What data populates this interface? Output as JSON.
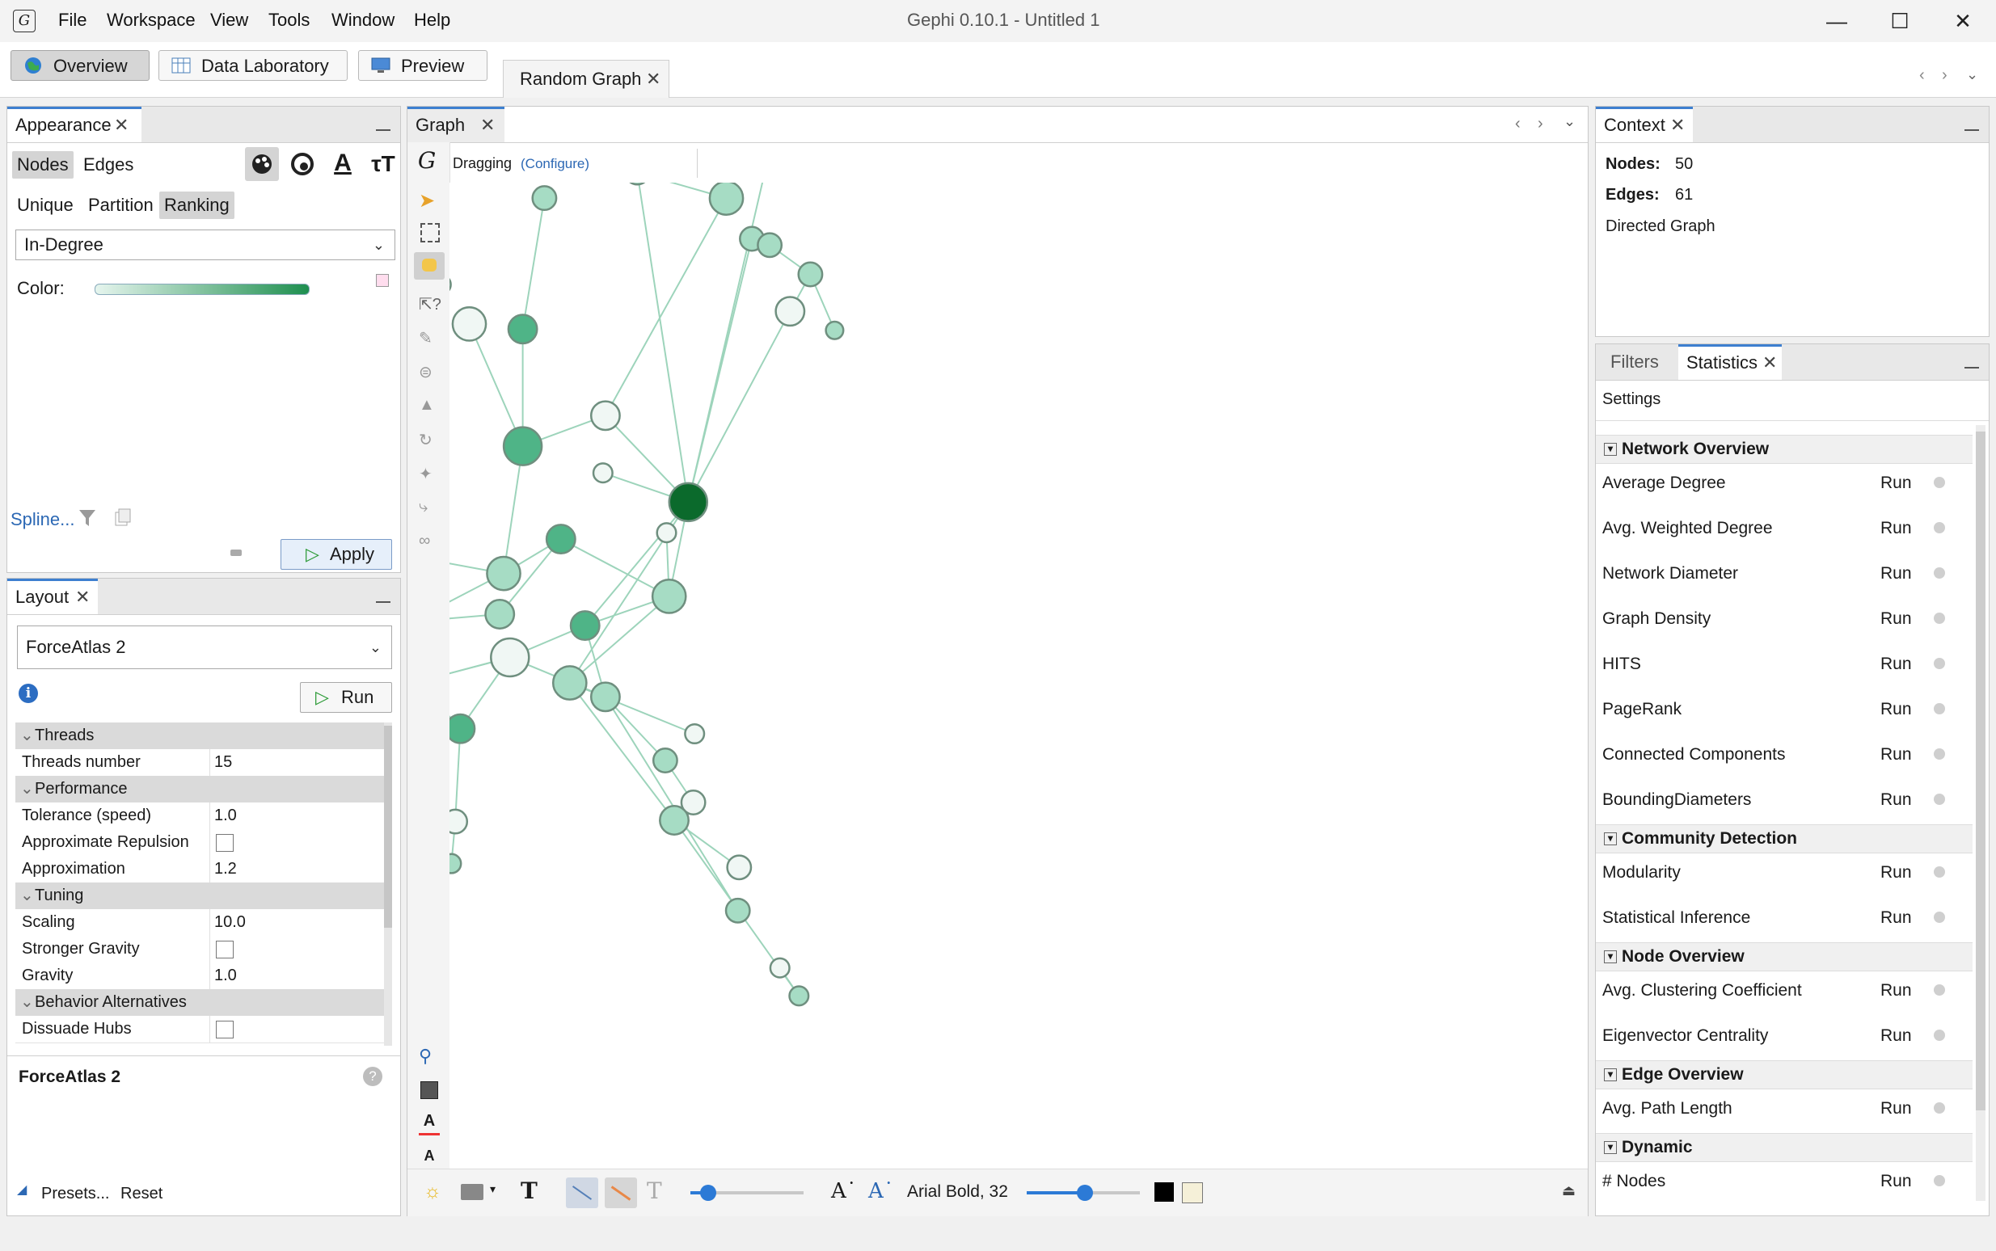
{
  "app": {
    "title": "Gephi 0.10.1 - Untitled 1",
    "menu": [
      "File",
      "Workspace",
      "View",
      "Tools",
      "Window",
      "Help"
    ]
  },
  "toolbar": {
    "overview": "Overview",
    "data_lab": "Data Laboratory",
    "preview": "Preview",
    "workspace_tab": "Random Graph"
  },
  "appearance": {
    "title": "Appearance",
    "tabs": [
      "Nodes",
      "Edges"
    ],
    "modes": [
      "Unique",
      "Partition",
      "Ranking"
    ],
    "attribute": "In-Degree",
    "color_label": "Color:",
    "gradient": [
      "#e6f5ee",
      "#1e8f4f"
    ],
    "spline_link": "Spline...",
    "apply": "Apply"
  },
  "layout": {
    "title": "Layout",
    "algorithm": "ForceAtlas 2",
    "run": "Run",
    "groups": [
      {
        "name": "Threads",
        "rows": [
          {
            "k": "Threads number",
            "v": "15"
          }
        ]
      },
      {
        "name": "Performance",
        "rows": [
          {
            "k": "Tolerance (speed)",
            "v": "1.0"
          },
          {
            "k": "Approximate Repulsion",
            "v": "",
            "check": true
          },
          {
            "k": "Approximation",
            "v": "1.2"
          }
        ]
      },
      {
        "name": "Tuning",
        "rows": [
          {
            "k": "Scaling",
            "v": "10.0"
          },
          {
            "k": "Stronger Gravity",
            "v": "",
            "check": true
          },
          {
            "k": "Gravity",
            "v": "1.0"
          }
        ]
      },
      {
        "name": "Behavior Alternatives",
        "rows": [
          {
            "k": "Dissuade Hubs",
            "v": "",
            "check": true
          }
        ]
      }
    ],
    "desc_title": "ForceAtlas 2",
    "presets": "Presets...",
    "reset": "Reset"
  },
  "graph": {
    "tab": "Graph",
    "mode": "Dragging",
    "configure": "(Configure)",
    "font_label": "Arial Bold, 32",
    "node_colors": {
      "light": "#f0f7f4",
      "mid": "#a6dcc4",
      "dark": "#4fb487",
      "darkest": "#0b6a2c"
    }
  },
  "context": {
    "title": "Context",
    "nodes_label": "Nodes:",
    "nodes_value": "50",
    "edges_label": "Edges:",
    "edges_value": "61",
    "graph_type": "Directed Graph"
  },
  "statistics": {
    "tabs": [
      "Filters",
      "Statistics"
    ],
    "settings": "Settings",
    "run_label": "Run",
    "sections": [
      {
        "title": "Network Overview",
        "items": [
          "Average Degree",
          "Avg. Weighted Degree",
          "Network Diameter",
          "Graph Density",
          "HITS",
          "PageRank",
          "Connected Components",
          "BoundingDiameters"
        ]
      },
      {
        "title": "Community Detection",
        "items": [
          "Modularity",
          "Statistical Inference"
        ]
      },
      {
        "title": "Node Overview",
        "items": [
          "Avg. Clustering Coefficient",
          "Eigenvector Centrality"
        ]
      },
      {
        "title": "Edge Overview",
        "items": [
          "Avg. Path Length"
        ]
      },
      {
        "title": "Dynamic",
        "items": [
          "# Nodes"
        ]
      }
    ]
  }
}
